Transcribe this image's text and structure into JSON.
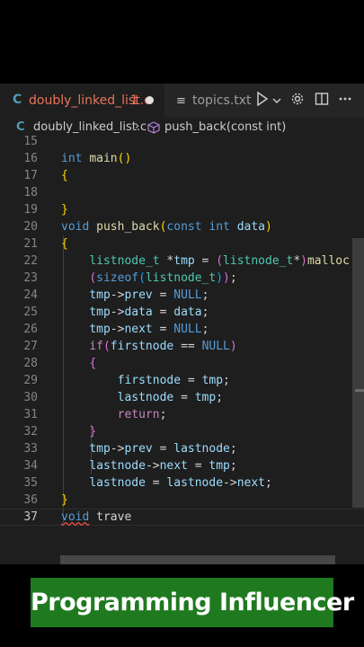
{
  "tabs": {
    "active": {
      "lang_icon": "C",
      "name": "doubly_linked_list.c",
      "problems": "1",
      "unsaved_icon": "dot-icon"
    },
    "second": {
      "icon": "lines-icon",
      "name": "topics.txt"
    }
  },
  "actions": [
    "run-icon",
    "chevron-down-icon",
    "gear-icon",
    "split-editor-icon",
    "more-icon"
  ],
  "breadcrumb": {
    "lang_icon": "C",
    "file": "doubly_linked_list.c",
    "separator": "›",
    "symbol_icon": "cube-icon",
    "function": "push_back(const int)"
  },
  "line_numbers": [
    "15",
    "16",
    "17",
    "18",
    "19",
    "20",
    "21",
    "22",
    "23",
    "24",
    "25",
    "26",
    "27",
    "28",
    "29",
    "30",
    "31",
    "32",
    "33",
    "34",
    "35",
    "36",
    "37"
  ],
  "current_line": "37",
  "code": {
    "l15": "",
    "l16": {
      "kw": "int",
      "sp": " ",
      "fn": "main",
      "paren": "()"
    },
    "l17": "{",
    "l18": "",
    "l19": "}",
    "l20": {
      "kw": "void",
      "sp": " ",
      "fn": "push_back",
      "open": "(",
      "const": "const",
      "sp2": " ",
      "int": "int",
      "sp3": " ",
      "param": "data",
      "close": ")"
    },
    "l21": "{",
    "l22": {
      "indent": "    ",
      "type": "listnode_t",
      "a": " *",
      "var": "tmp",
      "b": " = ",
      "open": "(",
      "type2": "listnode_t",
      "c": "*",
      "close": ")",
      "fn": "malloc"
    },
    "l23": {
      "indent": "    ",
      "open": "(",
      "kw": "sizeof",
      "open2": "(",
      "type": "listnode_t",
      "close2": ")",
      "close": ")",
      "semi": ";"
    },
    "l24": {
      "indent": "    ",
      "a": "tmp",
      "arrow": "->",
      "b": "prev",
      "eq": " = ",
      "val": "NULL",
      "semi": ";"
    },
    "l25": {
      "indent": "    ",
      "a": "tmp",
      "arrow": "->",
      "b": "data",
      "eq": " = ",
      "val": "data",
      "semi": ";"
    },
    "l26": {
      "indent": "    ",
      "a": "tmp",
      "arrow": "->",
      "b": "next",
      "eq": " = ",
      "val": "NULL",
      "semi": ";"
    },
    "l27": {
      "indent": "    ",
      "kw": "if",
      "open": "(",
      "a": "firstnode",
      "eq": " == ",
      "val": "NULL",
      "close": ")"
    },
    "l28": {
      "indent": "    ",
      "brace": "{"
    },
    "l29": {
      "indent": "        ",
      "a": "firstnode",
      "eq": " = ",
      "b": "tmp",
      "semi": ";"
    },
    "l30": {
      "indent": "        ",
      "a": "lastnode",
      "eq": " = ",
      "b": "tmp",
      "semi": ";"
    },
    "l31": {
      "indent": "        ",
      "kw": "return",
      "semi": ";"
    },
    "l32": {
      "indent": "    ",
      "brace": "}"
    },
    "l33": {
      "indent": "    ",
      "a": "tmp",
      "arrow": "->",
      "b": "prev",
      "eq": " = ",
      "c": "lastnode",
      "semi": ";"
    },
    "l34": {
      "indent": "    ",
      "a": "lastnode",
      "arrow": "->",
      "b": "next",
      "eq": " = ",
      "c": "tmp",
      "semi": ";"
    },
    "l35": {
      "indent": "    ",
      "a": "lastnode",
      "eq": " = ",
      "b": "lastnode",
      "arrow": "->",
      "c": "next",
      "semi": ";"
    },
    "l36": "}",
    "l37": {
      "kw": "void",
      "sp": " ",
      "ident": "trave"
    }
  },
  "banner": {
    "text": "Programming Influencer",
    "color": "#1f7a1f"
  },
  "colors": {
    "editor_bg": "#1e1e1e",
    "keyword": "#569cd6",
    "function": "#dcdcaa",
    "variable": "#9cdcfe",
    "type": "#4ec9b0",
    "control": "#c586c0",
    "modified_tab": "#e8735a"
  }
}
